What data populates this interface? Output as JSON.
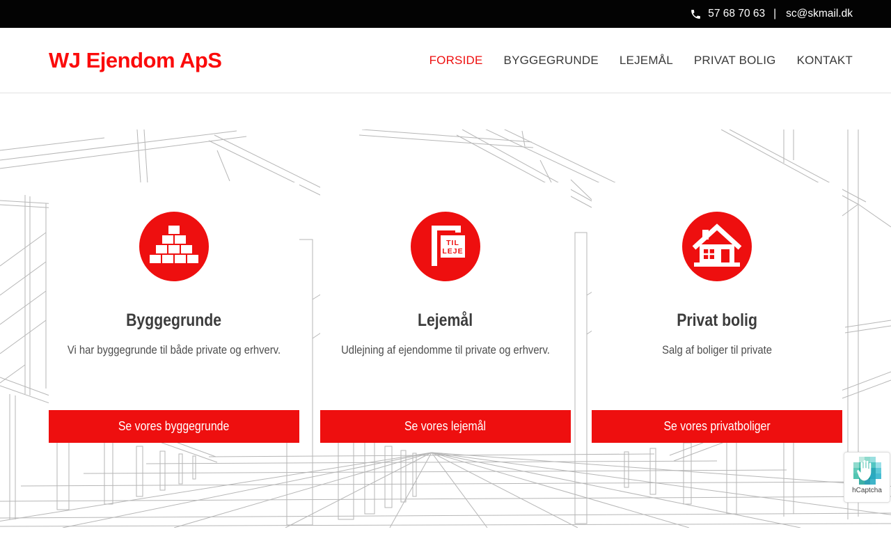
{
  "topbar": {
    "phone": "57 68 70 63",
    "separator": "|",
    "email": "sc@skmail.dk"
  },
  "header": {
    "logo": "WJ Ejendom ApS",
    "nav": [
      {
        "label": "FORSIDE",
        "active": true
      },
      {
        "label": "BYGGEGRUNDE",
        "active": false
      },
      {
        "label": "LEJEMÅL",
        "active": false
      },
      {
        "label": "PRIVAT BOLIG",
        "active": false
      },
      {
        "label": "KONTAKT",
        "active": false
      }
    ]
  },
  "cards": [
    {
      "icon": "bricks-icon",
      "title": "Byggegrunde",
      "description": "Vi har byggegrunde til både private og erhverv.",
      "button": "Se vores byggegrunde"
    },
    {
      "icon": "for-rent-sign-icon",
      "title": "Lejemål",
      "description": "Udlejning af ejendomme til private og erhverv.",
      "button": "Se vores lejemål",
      "sign": {
        "line1": "TIL",
        "line2": "LEJE"
      }
    },
    {
      "icon": "house-icon",
      "title": "Privat bolig",
      "description": "Salg af boliger til private",
      "button": "Se vores privatboliger"
    }
  ],
  "captcha": {
    "label": "hCaptcha"
  },
  "colors": {
    "accent_red": "#ee0f0f",
    "logo_red": "#fb0b0b",
    "topbar_bg": "#030303",
    "nav_text": "#3a3a3a",
    "body_text": "#4d4d4d",
    "sketch_line": "#b6b6b6"
  }
}
